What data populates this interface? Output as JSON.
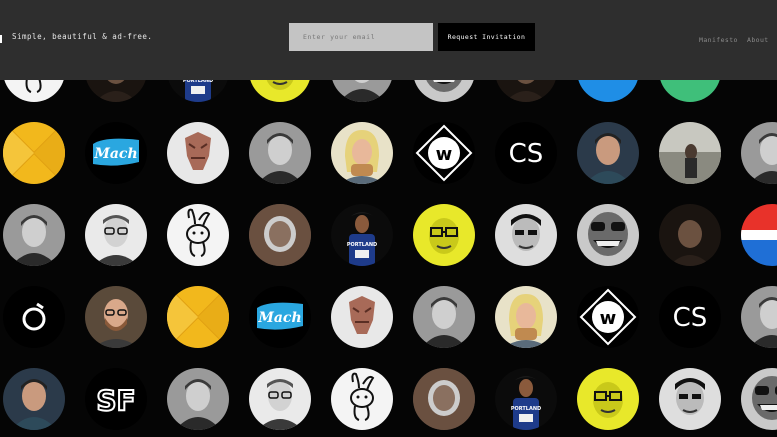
{
  "header": {
    "tagline": "Simple, beautiful & ad-free.",
    "email_placeholder": "Enter your email",
    "request_label": "Request Invitation",
    "nav": [
      "Manifesto",
      "About"
    ]
  },
  "colors": {
    "topbar": "#2e2e2e",
    "background": "#050505",
    "input_bg": "#c4c4c4",
    "button_bg": "#000000"
  },
  "avatars": [
    [
      "cartoon-bunny",
      "photo-dark",
      "runner",
      "yellow-face",
      "photo-bw",
      "grinning-face",
      "photo-dark",
      "blue-circle",
      "green-circle",
      ""
    ],
    [
      "yellow-x",
      "mach-logo",
      "mask-figure",
      "photo-bw-man",
      "blonde-woman",
      "w-logo",
      "cs-logo",
      "photo-man",
      "photo-lake",
      "photo-bw-man"
    ],
    [
      "photo-bw-man",
      "photo-glasses-man",
      "cartoon-bunny",
      "bw-mirror",
      "runner",
      "yellow-face",
      "photo-asian-man",
      "grinning-face",
      "photo-dark",
      "red-blue"
    ],
    [
      "o-logo",
      "photo-bearded-man",
      "yellow-x",
      "mach-logo",
      "mask-figure",
      "photo-bw-man",
      "blonde-woman",
      "w-logo",
      "cs-logo",
      "photo-bw-man"
    ],
    [
      "photo-man",
      "sf-logo",
      "photo-bw-man",
      "photo-glasses-man",
      "cartoon-bunny",
      "bw-mirror",
      "runner",
      "yellow-face",
      "photo-asian-man",
      "grinning-face"
    ]
  ]
}
